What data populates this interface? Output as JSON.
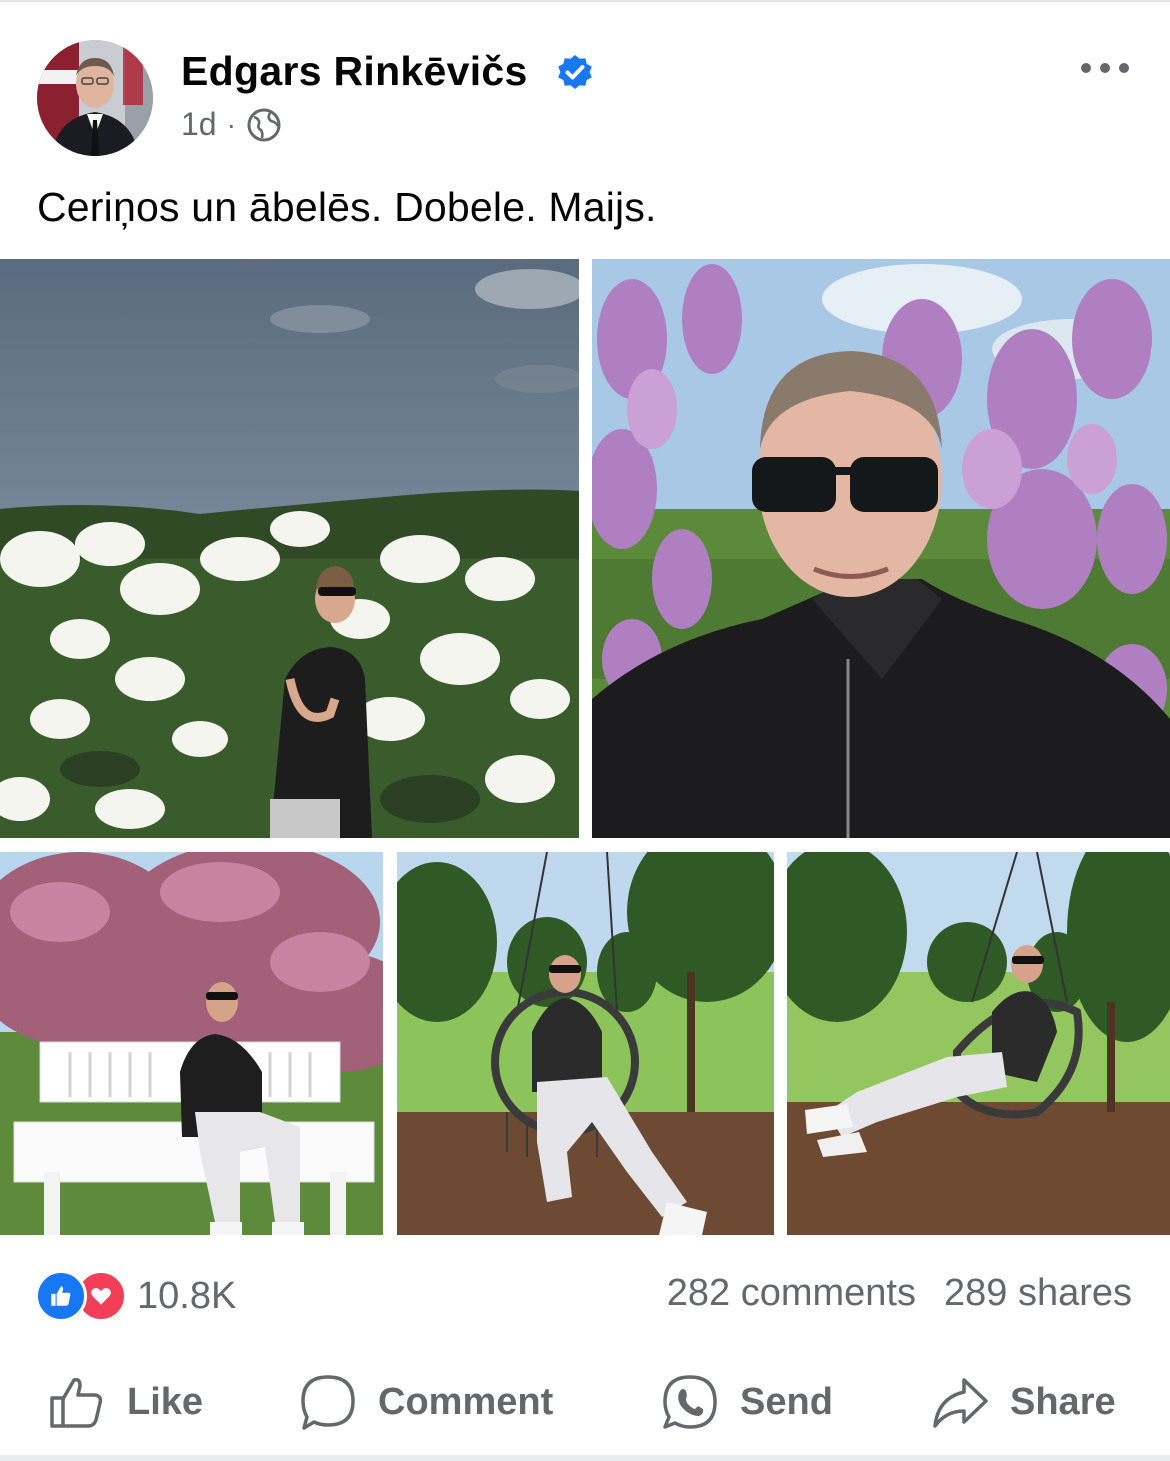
{
  "post": {
    "author": "Edgars Rinkēvičs",
    "time": "1d",
    "separator": "·",
    "caption": "Ceriņos un ābelēs. Dobele. Maijs.",
    "audience_icon": "globe-icon",
    "verified_icon": "verified-badge-icon",
    "more_icon": "more-options-icon"
  },
  "photos": [
    {
      "alt": "Man standing among white lilac bushes under a cloudy sky"
    },
    {
      "alt": "Selfie of man with sunglasses in front of purple lilacs"
    },
    {
      "alt": "Man sitting on a white bench under pink blossoming apple tree"
    },
    {
      "alt": "Man sitting in a hanging swing chair in a park"
    },
    {
      "alt": "Man leaning back in a hanging swing chair"
    }
  ],
  "stats": {
    "reactions_count": "10.8K",
    "comments": "282 comments",
    "shares": "289 shares",
    "reaction_icons": [
      "like-reaction-icon",
      "love-reaction-icon"
    ]
  },
  "actions": {
    "like": "Like",
    "comment": "Comment",
    "send": "Send",
    "share": "Share"
  },
  "colors": {
    "brand_blue": "#1877f2",
    "love_red": "#f33e58",
    "secondary_text": "#65676b"
  }
}
